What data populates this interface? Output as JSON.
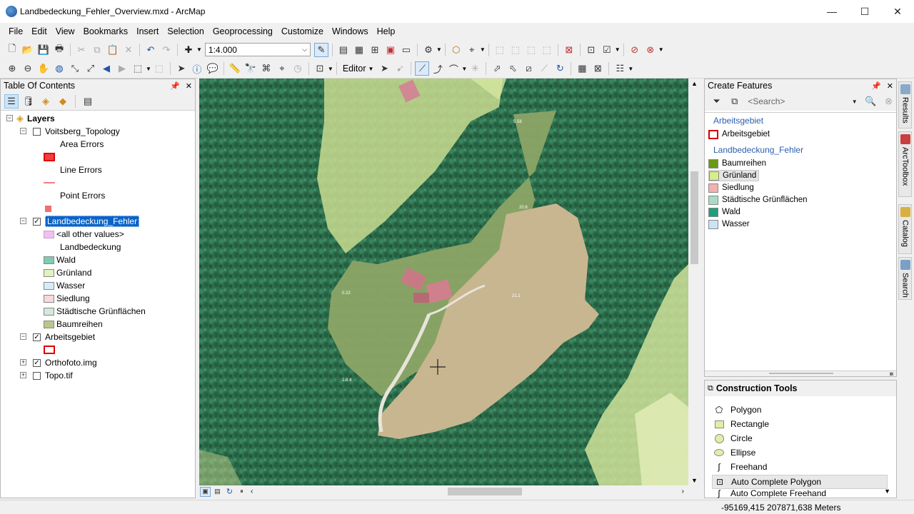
{
  "window": {
    "title": "Landbedeckung_Fehler_Overview.mxd - ArcMap",
    "controls": {
      "minimize": "—",
      "maximize": "☐",
      "close": "✕"
    }
  },
  "menu": [
    "File",
    "Edit",
    "View",
    "Bookmarks",
    "Insert",
    "Selection",
    "Geoprocessing",
    "Customize",
    "Windows",
    "Help"
  ],
  "toolbar": {
    "scale": "1:4.000",
    "editor_label": "Editor"
  },
  "toc": {
    "title": "Table Of Contents",
    "root": "Layers",
    "topology": {
      "name": "Voitsberg_Topology",
      "checked": false,
      "area_errors": "Area Errors",
      "line_errors": "Line Errors",
      "point_errors": "Point Errors"
    },
    "landbedeckung": {
      "name": "Landbedeckung_Fehler",
      "checked": true,
      "other_values": "<all other values>",
      "field_heading": "Landbedeckung",
      "classes": [
        {
          "label": "Wald",
          "color": "#7dcdb0"
        },
        {
          "label": "Grünland",
          "color": "#e4f0c0"
        },
        {
          "label": "Wasser",
          "color": "#d6ecf8"
        },
        {
          "label": "Siedlung",
          "color": "#f8d8d8"
        },
        {
          "label": "Städtische Grünflächen",
          "color": "#d6e8dc"
        },
        {
          "label": "Baumreihen",
          "color": "#b8c888"
        }
      ],
      "other_color": "#f0c0f0"
    },
    "arbeitsgebiet": {
      "name": "Arbeitsgebiet",
      "checked": true
    },
    "orthofoto": {
      "name": "Orthofoto.img",
      "checked": true
    },
    "topo": {
      "name": "Topo.tif",
      "checked": false
    }
  },
  "map": {
    "labels": [
      "5.58",
      "20.8",
      "0.22",
      "21.1",
      "1.8.4"
    ]
  },
  "create_features": {
    "title": "Create Features",
    "search_placeholder": "<Search>",
    "groups": [
      {
        "name": "Arbeitsgebiet",
        "templates": [
          {
            "label": "Arbeitsgebiet",
            "color": "#ffffff",
            "outline": "#d00000"
          }
        ]
      },
      {
        "name": "Landbedeckung_Fehler",
        "templates": [
          {
            "label": "Baumreihen",
            "color": "#6a9a10"
          },
          {
            "label": "Grünland",
            "color": "#d8ec88"
          },
          {
            "label": "Siedlung",
            "color": "#f4b0b0"
          },
          {
            "label": "Städtische Grünflächen",
            "color": "#a8dcc4"
          },
          {
            "label": "Wald",
            "color": "#1f9e7c"
          },
          {
            "label": "Wasser",
            "color": "#c8e4f8"
          }
        ]
      }
    ]
  },
  "construction_tools": {
    "title": "Construction Tools",
    "tools": [
      "Polygon",
      "Rectangle",
      "Circle",
      "Ellipse",
      "Freehand",
      "Auto Complete Polygon",
      "Auto Complete Freehand"
    ]
  },
  "dock_tabs": [
    "Results",
    "ArcToolbox",
    "Catalog",
    "Search"
  ],
  "status": {
    "coordinates": "-95169,415  207871,638 Meters"
  }
}
